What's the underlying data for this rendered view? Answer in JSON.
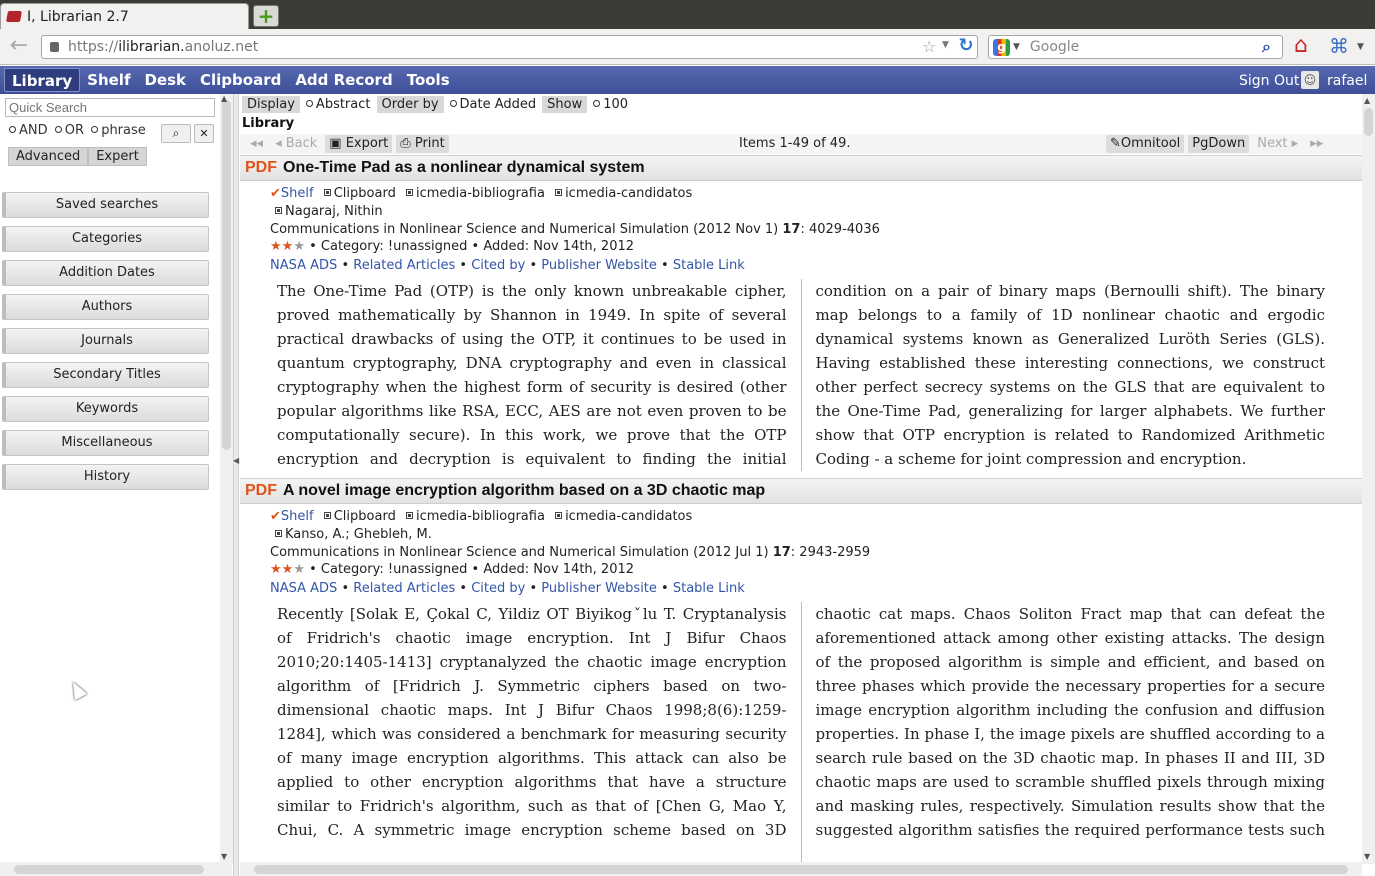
{
  "browser": {
    "tab_title": "I, Librarian 2.7",
    "url_scheme": "https://",
    "url_sub": "ilibrarian.",
    "url_domain": "anoluz.net",
    "search_placeholder": "Google"
  },
  "nav": {
    "items": [
      "Library",
      "Shelf",
      "Desk",
      "Clipboard",
      "Add Record",
      "Tools"
    ],
    "sign_out": "Sign Out",
    "username": "rafael"
  },
  "sidebar": {
    "quick_search_placeholder": "Quick Search",
    "opt_and": "AND",
    "opt_or": "OR",
    "opt_phrase": "phrase",
    "advanced": "Advanced",
    "expert": "Expert",
    "buttons": [
      "Saved searches",
      "Categories",
      "Addition Dates",
      "Authors",
      "Journals",
      "Secondary Titles",
      "Keywords",
      "Miscellaneous",
      "History"
    ]
  },
  "toolbar": {
    "display": "Display",
    "abstract": "Abstract",
    "order_by": "Order by",
    "date_added": "Date Added",
    "show": "Show",
    "count": "100"
  },
  "library_title": "Library",
  "pager": {
    "back": "Back",
    "export": "Export",
    "print": "Print",
    "items": "Items 1-49 of 49.",
    "omnitool": "Omnitool",
    "pgdown": "PgDown",
    "next": "Next"
  },
  "links": {
    "nasa": "NASA ADS",
    "related": "Related Articles",
    "cited": "Cited by",
    "publisher": "Publisher Website",
    "stable": "Stable Link",
    "shelf": "Shelf",
    "clipboard": "Clipboard",
    "sep": "•"
  },
  "records": [
    {
      "pdf": "PDF",
      "title": "One-Time Pad as a nonlinear dynamical system",
      "tag1": "icmedia-bibliografia",
      "tag2": "icmedia-candidatos",
      "authors": "Nagaraj, Nithin",
      "journal": "Communications in Nonlinear Science and Numerical Simulation (2012 Nov 1) ",
      "volume": "17",
      "pages": ": 4029-4036",
      "rating": 2,
      "category": "• Category: !unassigned • Added: Nov 14th, 2012",
      "abstract": "The One-Time Pad (OTP) is the only known unbreakable cipher, proved mathematically by Shannon in 1949. In spite of several practical drawbacks of using the OTP, it continues to be used in quantum cryptography, DNA cryptography and even in classical cryptography when the highest form of security is desired (other popular algorithms like RSA, ECC, AES are not even proven to be computationally secure). In this work, we prove that the OTP encryption and decryption is equivalent to finding the initial condition on a pair of binary maps (Bernoulli shift). The binary map belongs to a family of 1D nonlinear chaotic and ergodic dynamical systems known as Generalized Luröth Series (GLS). Having established these interesting connections, we construct other perfect secrecy systems on the GLS that are equivalent to the One-Time Pad, generalizing for larger alphabets. We further show that OTP encryption is related to Randomized Arithmetic Coding - a scheme for joint compression and encryption."
    },
    {
      "pdf": "PDF",
      "title": "A novel image encryption algorithm based on a 3D chaotic map",
      "tag1": "icmedia-bibliografia",
      "tag2": "icmedia-candidatos",
      "authors": "Kanso, A.; Ghebleh, M.",
      "journal": "Communications in Nonlinear Science and Numerical Simulation (2012 Jul 1) ",
      "volume": "17",
      "pages": ": 2943-2959",
      "rating": 2,
      "category": "• Category: !unassigned • Added: Nov 14th, 2012",
      "abstract": "Recently [Solak E, Çokal C, Yildiz OT Biyikogˇlu T. Cryptanalysis of Fridrich's chaotic image encryption. Int J Bifur Chaos 2010;20:1405-1413] cryptanalyzed the chaotic image encryption algorithm of [Fridrich J. Symmetric ciphers based on two-dimensional chaotic maps. Int J Bifur Chaos 1998;8(6):1259-1284], which was considered a benchmark for measuring security of many image encryption algorithms. This attack can also be applied to other encryption algorithms that have a structure similar to Fridrich's algorithm, such as that of [Chen G, Mao Y, Chui, C. A symmetric image encryption scheme based on 3D chaotic cat maps. Chaos Soliton Fract map that can defeat the aforementioned attack among other existing attacks. The design of the proposed algorithm is simple and efficient, and based on three phases which provide the necessary properties for a secure image encryption algorithm including the confusion and diffusion properties. In phase I, the image pixels are shuffled according to a search rule based on the 3D chaotic map. In phases II and III, 3D chaotic maps are used to scramble shuffled pixels through mixing and masking rules, respectively. Simulation results show that the suggested algorithm satisfies the required performance tests such as high level security, large key space and acceptable encryption speed."
    }
  ]
}
